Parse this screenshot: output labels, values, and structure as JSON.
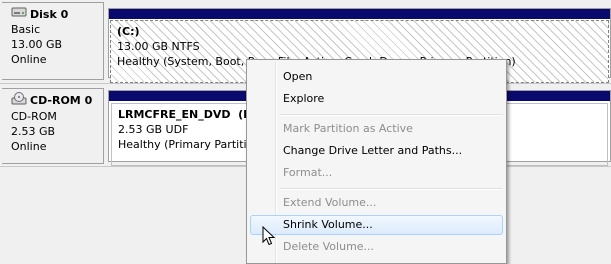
{
  "disks": [
    {
      "name": "Disk 0",
      "icon": "hard-disk-icon",
      "type": "Basic",
      "size": "13.00 GB",
      "status": "Online",
      "volume": {
        "label": "(C:)",
        "info": "13.00 GB NTFS",
        "health": "Healthy (System, Boot, Page File, Active, Crash Dump, Primary Partition)"
      }
    },
    {
      "name": "CD-ROM 0",
      "icon": "cd-rom-icon",
      "type": "CD-ROM",
      "size": "2.53 GB",
      "status": "Online",
      "volume": {
        "label": "LRMCFRE_EN_DVD  (D:)",
        "info": "2.53 GB UDF",
        "health": "Healthy (Primary Partition)"
      }
    }
  ],
  "context_menu": {
    "items": [
      {
        "label": "Open",
        "enabled": true
      },
      {
        "label": "Explore",
        "enabled": true
      },
      {
        "label": "Mark Partition as Active",
        "enabled": false
      },
      {
        "label": "Change Drive Letter and Paths...",
        "enabled": true
      },
      {
        "label": "Format...",
        "enabled": false
      },
      {
        "label": "Extend Volume...",
        "enabled": false
      },
      {
        "label": "Shrink Volume...",
        "enabled": true,
        "highlighted": true
      },
      {
        "label": "Delete Volume...",
        "enabled": false
      }
    ]
  },
  "colors": {
    "volume_bar": "#0a0a6e",
    "menu_highlight_border": "#a8d3fb",
    "disabled_text": "#8d8d8d"
  }
}
